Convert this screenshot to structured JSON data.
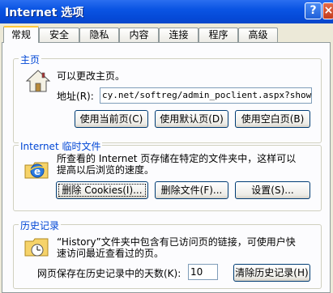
{
  "window": {
    "title": "Internet 选项",
    "help_label": "?",
    "close_label": "×"
  },
  "tabs": [
    {
      "label": "常规"
    },
    {
      "label": "安全"
    },
    {
      "label": "隐私"
    },
    {
      "label": "内容"
    },
    {
      "label": "连接"
    },
    {
      "label": "程序"
    },
    {
      "label": "高级"
    }
  ],
  "homepage": {
    "legend": "主页",
    "description": "可以更改主页。",
    "address_label": "地址",
    "address_key": "(R):",
    "address_value": "cy.net/softreg/admin_poclient.aspx?show=1",
    "btn_current": "使用当前页(C)",
    "btn_default": "使用默认页(D)",
    "btn_blank": "使用空白页(B)"
  },
  "temp_files": {
    "legend": "Internet 临时文件",
    "desc_line1": "所查看的 Internet 页存储在特定的文件夹中，这样可以",
    "desc_line2": "提高以后浏览的速度。",
    "btn_cookies": "删除 Cookies(I)...",
    "btn_files": "删除文件(F)...",
    "btn_settings": "设置(S)..."
  },
  "history": {
    "legend": "历史记录",
    "desc_line1": "“History”文件夹中包含有已访问页的链接，可使用户快",
    "desc_line2": "速访问最近查看过的页。",
    "days_label": "网页保存在历史记录中的天数(K):",
    "days_value": "10",
    "btn_clear": "清除历史记录(H)"
  },
  "icons": {
    "home": "house-icon",
    "ie": "internet-explorer-icon",
    "history": "history-folder-icon"
  }
}
